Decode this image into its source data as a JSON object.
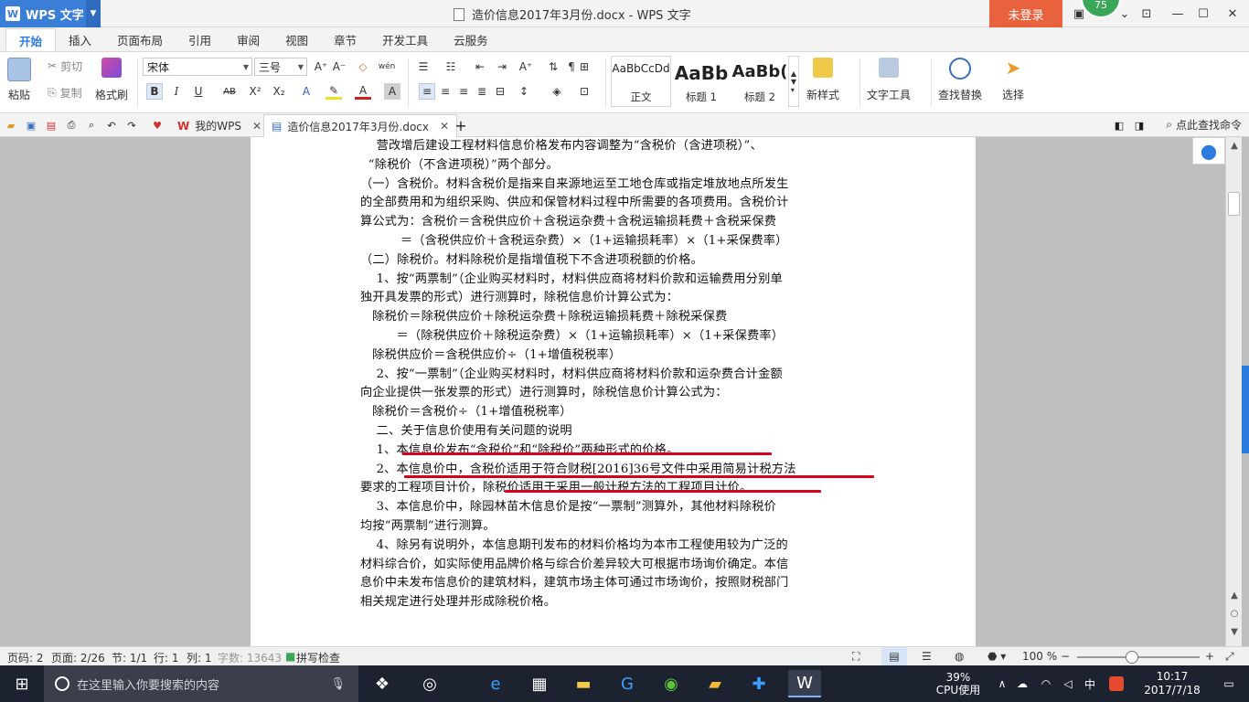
{
  "titlebar": {
    "app_name": "WPS 文字",
    "doc_title": "造价信息2017年3月份.docx - WPS 文字",
    "login": "未登录",
    "badge": "75"
  },
  "menu": {
    "tabs": [
      "开始",
      "插入",
      "页面布局",
      "引用",
      "审阅",
      "视图",
      "章节",
      "开发工具",
      "云服务"
    ]
  },
  "ribbon": {
    "paste": "粘贴",
    "cut": "剪切",
    "copy": "复制",
    "format_painter": "格式刷",
    "font": "宋体",
    "size": "三号",
    "styles": [
      {
        "sample": "AaBbCcDd",
        "label": "正文"
      },
      {
        "sample": "AaBb",
        "label": "标题 1"
      },
      {
        "sample": "AaBb(",
        "label": "标题 2"
      }
    ],
    "new_style": "新样式",
    "text_tools": "文字工具",
    "find_replace": "查找替换",
    "select": "选择"
  },
  "tabbar": {
    "my_wps": "我的WPS",
    "doc_tab": "造价信息2017年3月份.docx",
    "find_command": "点此查找命令"
  },
  "document": {
    "lines": [
      "    营改增后建设工程材料信息价格发布内容调整为“含税价（含进项税）”、",
      "  “除税价（不含进项税）”两个部分。",
      "（一）含税价。材料含税价是指来自来源地运至工地仓库或指定堆放地点所发生",
      "的全部费用和为组织采购、供应和保管材料过程中所需要的各项费用。含税价计",
      "算公式为：含税价＝含税供应价＋含税运杂费＋含税运输损耗费＋含税采保费",
      "          ＝（含税供应价＋含税运杂费）×（1+运输损耗率）×（1+采保费率）",
      "（二）除税价。材料除税价是指增值税下不含进项税额的价格。",
      "    1、按“两票制”（企业购买材料时，材料供应商将材料价款和运输费用分别单",
      "独开具发票的形式）进行测算时，除税信息价计算公式为：",
      "   除税价＝除税供应价＋除税运杂费＋除税运输损耗费＋除税采保费",
      "         ＝（除税供应价＋除税运杂费）×（1+运输损耗率）×（1+采保费率）",
      "   除税供应价＝含税供应价÷（1+增值税税率）",
      "    2、按“一票制”（企业购买材料时，材料供应商将材料价款和运杂费合计金额",
      "向企业提供一张发票的形式）进行测算时，除税信息价计算公式为：",
      "   除税价＝含税价÷（1+增值税税率）",
      "    二、关于信息价使用有关问题的说明",
      "    1、本信息价发布“含税价”和“除税价”两种形式的价格。",
      "    2、本信息价中，含税价适用于符合财税[2016]36号文件中采用简易计税方法",
      "要求的工程项目计价，除税价适用于采用一般计税方法的工程项目计价。",
      "    3、本信息价中，除园林苗木信息价是按“一票制”测算外，其他材料除税价",
      "均按“两票制”进行测算。",
      "    4、除另有说明外，本信息期刊发布的材料价格均为本市工程使用较为广泛的",
      "材料综合价，如实际使用品牌价格与综合价差异较大可根据市场询价确定。本信",
      "息价中未发布信息价的建筑材料，建筑市场主体可通过市场询价，按照财税部门",
      "相关规定进行处理并形成除税价格。"
    ]
  },
  "status": {
    "page_code": "页码: 2",
    "page": "页面: 2/26",
    "section": "节: 1/1",
    "row": "行: 1",
    "col": "列: 1",
    "chars": "字数: 13643",
    "spell": "拼写检查",
    "zoom": "100 %",
    "zoom_level": 0.45
  },
  "taskbar": {
    "search_placeholder": "在这里输入你要搜索的内容",
    "cpu": "39%",
    "cpu_label": "CPU使用",
    "ime": "中",
    "time": "10:17",
    "date": "2017/7/18"
  },
  "colors": {
    "accent": "#2b7be0",
    "login": "#e8623e",
    "redline": "#d8001a",
    "wps_blue": "#3b7ed8"
  }
}
